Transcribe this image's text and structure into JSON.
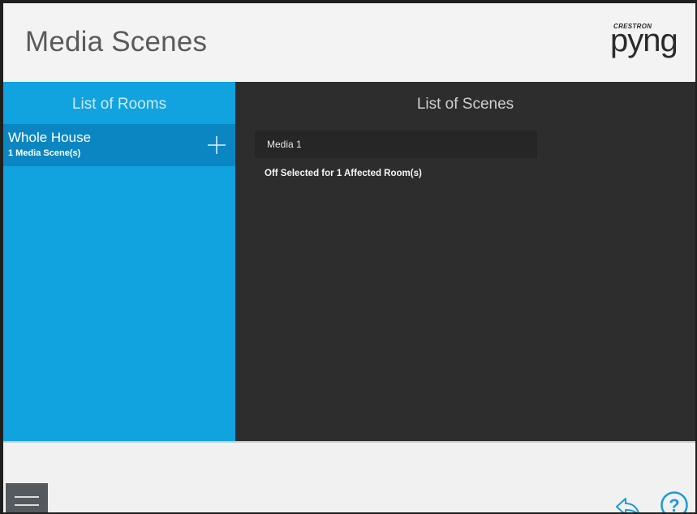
{
  "header": {
    "title": "Media Scenes",
    "logo_brand": "CRESTRON",
    "logo_product": "pyng"
  },
  "rooms_panel": {
    "heading": "List of Rooms",
    "rooms": [
      {
        "name": "Whole House",
        "scene_count": "1 Media Scene(s)"
      }
    ]
  },
  "scenes_panel": {
    "heading": "List of Scenes",
    "scenes": [
      {
        "label": "Media 1",
        "status": "Off Selected for 1 Affected Room(s)"
      }
    ]
  },
  "icons": {
    "add": "plus-icon",
    "menu": "hamburger-menu-icon",
    "back": "back-arrow-icon",
    "help": "help-question-icon"
  },
  "colors": {
    "rooms_panel": "#11a2e0",
    "selected_room": "#0b86c2",
    "scenes_panel": "#2d2d2d",
    "accent_icon": "#1a9ad8"
  }
}
